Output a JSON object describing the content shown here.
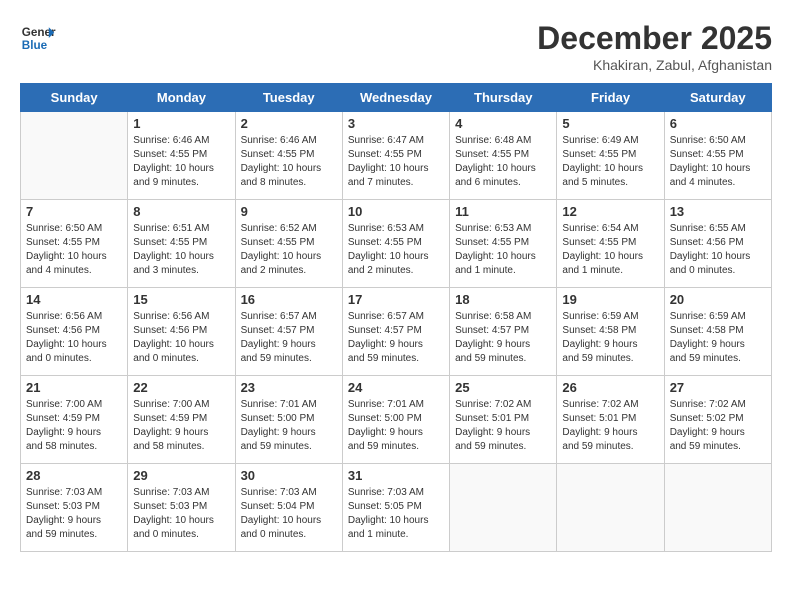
{
  "header": {
    "logo_line1": "General",
    "logo_line2": "Blue",
    "title": "December 2025",
    "subtitle": "Khakiran, Zabul, Afghanistan"
  },
  "calendar": {
    "days_of_week": [
      "Sunday",
      "Monday",
      "Tuesday",
      "Wednesday",
      "Thursday",
      "Friday",
      "Saturday"
    ],
    "weeks": [
      [
        {
          "day": "",
          "info": ""
        },
        {
          "day": "1",
          "info": "Sunrise: 6:46 AM\nSunset: 4:55 PM\nDaylight: 10 hours\nand 9 minutes."
        },
        {
          "day": "2",
          "info": "Sunrise: 6:46 AM\nSunset: 4:55 PM\nDaylight: 10 hours\nand 8 minutes."
        },
        {
          "day": "3",
          "info": "Sunrise: 6:47 AM\nSunset: 4:55 PM\nDaylight: 10 hours\nand 7 minutes."
        },
        {
          "day": "4",
          "info": "Sunrise: 6:48 AM\nSunset: 4:55 PM\nDaylight: 10 hours\nand 6 minutes."
        },
        {
          "day": "5",
          "info": "Sunrise: 6:49 AM\nSunset: 4:55 PM\nDaylight: 10 hours\nand 5 minutes."
        },
        {
          "day": "6",
          "info": "Sunrise: 6:50 AM\nSunset: 4:55 PM\nDaylight: 10 hours\nand 4 minutes."
        }
      ],
      [
        {
          "day": "7",
          "info": "Sunrise: 6:50 AM\nSunset: 4:55 PM\nDaylight: 10 hours\nand 4 minutes."
        },
        {
          "day": "8",
          "info": "Sunrise: 6:51 AM\nSunset: 4:55 PM\nDaylight: 10 hours\nand 3 minutes."
        },
        {
          "day": "9",
          "info": "Sunrise: 6:52 AM\nSunset: 4:55 PM\nDaylight: 10 hours\nand 2 minutes."
        },
        {
          "day": "10",
          "info": "Sunrise: 6:53 AM\nSunset: 4:55 PM\nDaylight: 10 hours\nand 2 minutes."
        },
        {
          "day": "11",
          "info": "Sunrise: 6:53 AM\nSunset: 4:55 PM\nDaylight: 10 hours\nand 1 minute."
        },
        {
          "day": "12",
          "info": "Sunrise: 6:54 AM\nSunset: 4:55 PM\nDaylight: 10 hours\nand 1 minute."
        },
        {
          "day": "13",
          "info": "Sunrise: 6:55 AM\nSunset: 4:56 PM\nDaylight: 10 hours\nand 0 minutes."
        }
      ],
      [
        {
          "day": "14",
          "info": "Sunrise: 6:56 AM\nSunset: 4:56 PM\nDaylight: 10 hours\nand 0 minutes."
        },
        {
          "day": "15",
          "info": "Sunrise: 6:56 AM\nSunset: 4:56 PM\nDaylight: 10 hours\nand 0 minutes."
        },
        {
          "day": "16",
          "info": "Sunrise: 6:57 AM\nSunset: 4:57 PM\nDaylight: 9 hours\nand 59 minutes."
        },
        {
          "day": "17",
          "info": "Sunrise: 6:57 AM\nSunset: 4:57 PM\nDaylight: 9 hours\nand 59 minutes."
        },
        {
          "day": "18",
          "info": "Sunrise: 6:58 AM\nSunset: 4:57 PM\nDaylight: 9 hours\nand 59 minutes."
        },
        {
          "day": "19",
          "info": "Sunrise: 6:59 AM\nSunset: 4:58 PM\nDaylight: 9 hours\nand 59 minutes."
        },
        {
          "day": "20",
          "info": "Sunrise: 6:59 AM\nSunset: 4:58 PM\nDaylight: 9 hours\nand 59 minutes."
        }
      ],
      [
        {
          "day": "21",
          "info": "Sunrise: 7:00 AM\nSunset: 4:59 PM\nDaylight: 9 hours\nand 58 minutes."
        },
        {
          "day": "22",
          "info": "Sunrise: 7:00 AM\nSunset: 4:59 PM\nDaylight: 9 hours\nand 58 minutes."
        },
        {
          "day": "23",
          "info": "Sunrise: 7:01 AM\nSunset: 5:00 PM\nDaylight: 9 hours\nand 59 minutes."
        },
        {
          "day": "24",
          "info": "Sunrise: 7:01 AM\nSunset: 5:00 PM\nDaylight: 9 hours\nand 59 minutes."
        },
        {
          "day": "25",
          "info": "Sunrise: 7:02 AM\nSunset: 5:01 PM\nDaylight: 9 hours\nand 59 minutes."
        },
        {
          "day": "26",
          "info": "Sunrise: 7:02 AM\nSunset: 5:01 PM\nDaylight: 9 hours\nand 59 minutes."
        },
        {
          "day": "27",
          "info": "Sunrise: 7:02 AM\nSunset: 5:02 PM\nDaylight: 9 hours\nand 59 minutes."
        }
      ],
      [
        {
          "day": "28",
          "info": "Sunrise: 7:03 AM\nSunset: 5:03 PM\nDaylight: 9 hours\nand 59 minutes."
        },
        {
          "day": "29",
          "info": "Sunrise: 7:03 AM\nSunset: 5:03 PM\nDaylight: 10 hours\nand 0 minutes."
        },
        {
          "day": "30",
          "info": "Sunrise: 7:03 AM\nSunset: 5:04 PM\nDaylight: 10 hours\nand 0 minutes."
        },
        {
          "day": "31",
          "info": "Sunrise: 7:03 AM\nSunset: 5:05 PM\nDaylight: 10 hours\nand 1 minute."
        },
        {
          "day": "",
          "info": ""
        },
        {
          "day": "",
          "info": ""
        },
        {
          "day": "",
          "info": ""
        }
      ]
    ]
  }
}
